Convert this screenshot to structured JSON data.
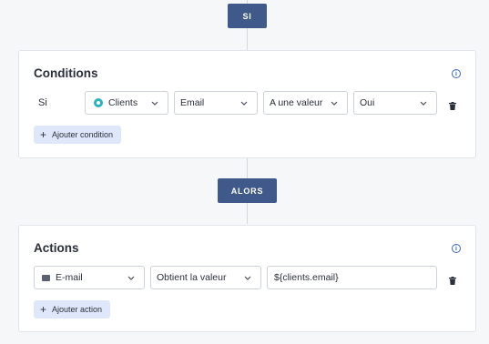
{
  "flow": {
    "if_pill": "SI",
    "then_pill": "ALORS"
  },
  "conditions": {
    "title": "Conditions",
    "info_icon": "i",
    "row_label": "Si",
    "object_select": "Clients",
    "field_select": "Email",
    "operator_select": "A une valeur",
    "value_select": "Oui",
    "add_label": "Ajouter condition"
  },
  "actions": {
    "title": "Actions",
    "info_icon": "i",
    "type_select": "E-mail",
    "mode_select": "Obtient la valeur",
    "value_input": "${clients.email}",
    "add_label": "Ajouter action"
  },
  "icons": {
    "clients": "clients-app-icon",
    "email": "envelope-icon",
    "delete": "trash-icon",
    "chevron": "chevron-down-icon",
    "info": "info-icon",
    "add": "plus-icon"
  },
  "colors": {
    "pill_bg": "#3f5a8a",
    "add_button_bg": "#dfe8fb",
    "info_blue": "#3c66b6",
    "clients_teal": "#29b3c2"
  }
}
